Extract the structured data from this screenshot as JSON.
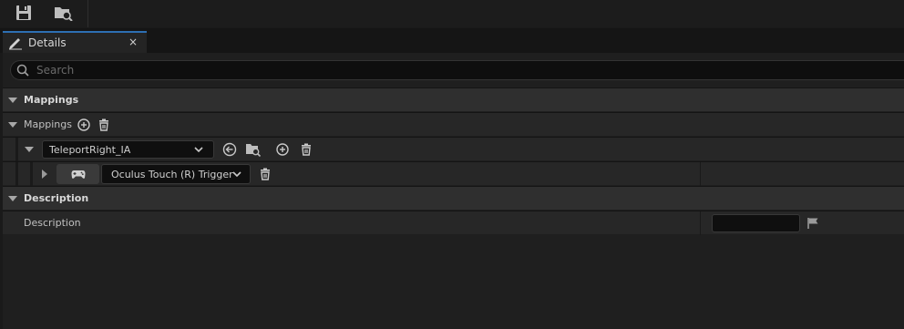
{
  "toolbar": {
    "icons": [
      "save-icon",
      "browse-icon"
    ]
  },
  "tab": {
    "label": "Details",
    "close": "×",
    "icon": "pencil-icon"
  },
  "search": {
    "placeholder": "Search"
  },
  "sections": {
    "mappings_category": "Mappings",
    "mappings_array_label": "Mappings",
    "action_value": "TeleportRight_IA",
    "key_value": "Oculus Touch (R) Trigger",
    "description_category": "Description",
    "description_label": "Description",
    "description_value": ""
  },
  "colors": {
    "accent": "#2d6fb3",
    "background": "#1a1a1a",
    "row": "#272727",
    "category": "#2f2f2f"
  }
}
